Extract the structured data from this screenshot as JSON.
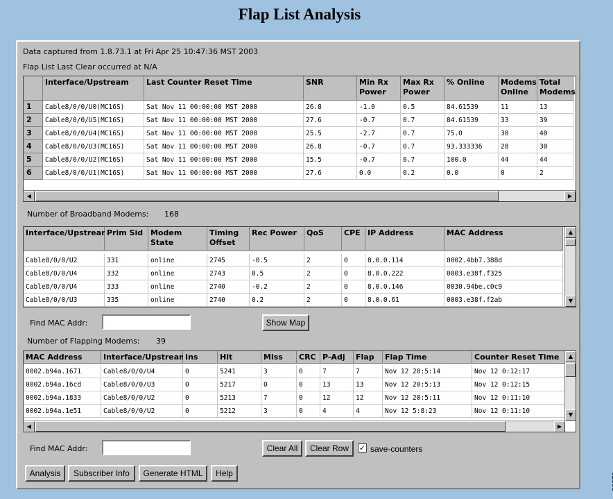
{
  "title": "Flap List Analysis",
  "captured": "Data captured from 1.8.73.1 at Fri Apr 25 10:47:36 MST 2003",
  "last_clear": "Flap List Last Clear occurred at N/A",
  "upstream_table": {
    "headers": [
      "Interface/Upstream",
      "Last Counter Reset Time",
      "SNR",
      "Min Rx Power",
      "Max Rx Power",
      "% Online",
      "Modems Online",
      "Total Modems"
    ],
    "rows": [
      {
        "n": "1",
        "c": [
          "Cable8/0/0/U0(MC16S)",
          "Sat Nov 11 00:00:00 MST 2000",
          "26.8",
          "-1.0",
          "0.5",
          "84.61539",
          "11",
          "13"
        ]
      },
      {
        "n": "2",
        "c": [
          "Cable8/0/0/U5(MC16S)",
          "Sat Nov 11 00:00:00 MST 2000",
          "27.6",
          "-0.7",
          "0.7",
          "84.61539",
          "33",
          "39"
        ]
      },
      {
        "n": "3",
        "c": [
          "Cable8/0/0/U4(MC16S)",
          "Sat Nov 11 00:00:00 MST 2000",
          "25.5",
          "-2.7",
          "0.7",
          "75.0",
          "30",
          "40"
        ]
      },
      {
        "n": "4",
        "c": [
          "Cable8/0/0/U3(MC16S)",
          "Sat Nov 11 00:00:00 MST 2000",
          "26.8",
          "-0.7",
          "0.7",
          "93.333336",
          "28",
          "30"
        ]
      },
      {
        "n": "5",
        "c": [
          "Cable8/0/0/U2(MC16S)",
          "Sat Nov 11 00:00:00 MST 2000",
          "15.5",
          "-0.7",
          "0.7",
          "100.0",
          "44",
          "44"
        ]
      },
      {
        "n": "6",
        "c": [
          "Cable8/0/0/U1(MC16S)",
          "Sat Nov 11 00:00:00 MST 2000",
          "27.6",
          "0.0",
          "0.2",
          "0.0",
          "0",
          "2"
        ]
      }
    ]
  },
  "broadband": {
    "label": "Number of Broadband Modems:",
    "count": "168"
  },
  "modem_table": {
    "headers": [
      "Interface/Upstream",
      "Prim Sid",
      "Modem State",
      "Timing Offset",
      "Rec Power",
      "QoS",
      "CPE",
      "IP Address",
      "MAC Address"
    ],
    "rows": [
      [
        "Cable8/0/0/U2",
        "331",
        "online",
        "2745",
        "-0.5",
        "2",
        "0",
        "8.0.0.114",
        "0002.4bb7.388d"
      ],
      [
        "Cable8/0/0/U4",
        "332",
        "online",
        "2743",
        "0.5",
        "2",
        "0",
        "8.0.0.222",
        "0003.e38f.f325"
      ],
      [
        "Cable8/0/0/U4",
        "333",
        "online",
        "2740",
        "-0.2",
        "2",
        "0",
        "8.0.0.146",
        "0030.94be.c0c9"
      ],
      [
        "Cable8/0/0/U3",
        "335",
        "online",
        "2740",
        "0.2",
        "2",
        "0",
        "8.0.0.61",
        "0003.e38f.f2ab"
      ]
    ]
  },
  "find_mac_label": "Find MAC Addr:",
  "show_map": "Show Map",
  "flapping": {
    "label": "Number of Flapping Modems:",
    "count": "39"
  },
  "flap_table": {
    "headers": [
      "MAC Address",
      "Interface/Upstream",
      "Ins",
      "Hit",
      "Miss",
      "CRC",
      "P-Adj",
      "Flap",
      "Flap Time",
      "Counter Reset Time"
    ],
    "rows": [
      [
        "0002.b94a.1671",
        "Cable8/0/0/U4",
        "0",
        "5241",
        "3",
        "0",
        "7",
        "7",
        "Nov 12 20:5:14",
        "Nov 12 0:12:17"
      ],
      [
        "0002.b94a.16cd",
        "Cable8/0/0/U3",
        "0",
        "5217",
        "0",
        "0",
        "13",
        "13",
        "Nov 12 20:5:13",
        "Nov 12 0:12:15"
      ],
      [
        "0002.b94a.1833",
        "Cable8/0/0/U2",
        "0",
        "5213",
        "7",
        "0",
        "12",
        "12",
        "Nov 12 20:5:11",
        "Nov 12 0:11:10"
      ],
      [
        "0002.b94a.1e51",
        "Cable8/0/0/U2",
        "0",
        "5212",
        "3",
        "0",
        "4",
        "4",
        "Nov 12 5:8:23",
        "Nov 12 0:11:10"
      ]
    ]
  },
  "buttons": {
    "clear_all": "Clear All",
    "clear_row": "Clear Row",
    "save_counters": "save-counters",
    "analysis": "Analysis",
    "subscriber_info": "Subscriber Info",
    "generate_html": "Generate HTML",
    "help": "Help"
  },
  "figure_id": "88878"
}
